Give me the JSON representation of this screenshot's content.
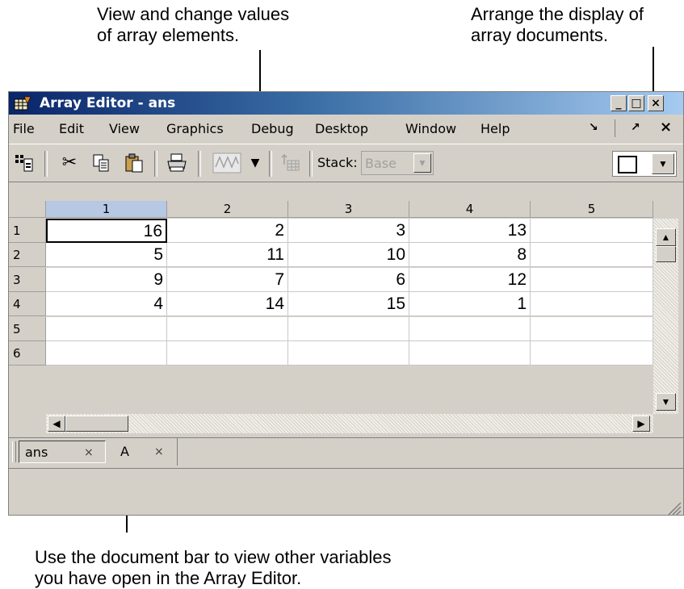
{
  "annotations": {
    "top_left": [
      "View and change values",
      "of array elements."
    ],
    "top_right": [
      "Arrange the display of",
      "array documents."
    ],
    "bottom": [
      "Use the document bar to view other variables",
      "you have open in the Array Editor."
    ]
  },
  "window": {
    "title": "Array Editor - ans",
    "controls": {
      "minimize": "_",
      "maximize": "□",
      "close": "×"
    }
  },
  "menu": {
    "items": [
      "File",
      "Edit",
      "View",
      "Graphics",
      "Debug",
      "Desktop",
      "Window",
      "Help"
    ],
    "undock": "↘",
    "dock": "↗",
    "close": "×"
  },
  "toolbar": {
    "stack_label": "Stack:",
    "stack_value": "Base"
  },
  "grid": {
    "columns": [
      "1",
      "2",
      "3",
      "4",
      "5"
    ],
    "rows": [
      "1",
      "2",
      "3",
      "4",
      "5",
      "6"
    ],
    "cells": [
      [
        "16",
        "2",
        "3",
        "13",
        ""
      ],
      [
        "5",
        "11",
        "10",
        "8",
        ""
      ],
      [
        "9",
        "7",
        "6",
        "12",
        ""
      ],
      [
        "4",
        "14",
        "15",
        "1",
        ""
      ],
      [
        "",
        "",
        "",
        "",
        ""
      ],
      [
        "",
        "",
        "",
        "",
        ""
      ]
    ],
    "selected_cell": "1,1"
  },
  "docbar": {
    "tabs": [
      {
        "label": "ans",
        "close": "×",
        "active": true
      },
      {
        "label": "A",
        "close": "×",
        "active": false
      }
    ]
  },
  "colors": {
    "title_start": "#0a246a",
    "title_end": "#a6caf0",
    "face": "#d4d0c8"
  }
}
